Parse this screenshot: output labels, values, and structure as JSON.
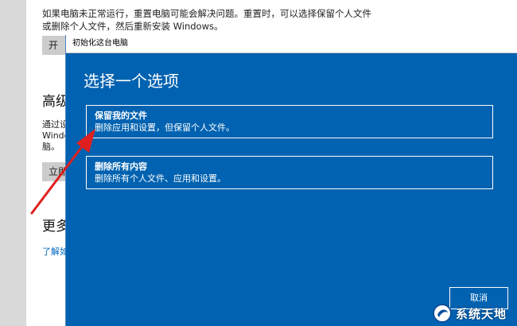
{
  "background": {
    "description": "如果电脑未正常运行，重置电脑可能会解决问题。重置时，可以选择保留个人文件或删除个人文件，然后重新安装 Windows。",
    "start_button_label": "开",
    "advanced_heading": "高级",
    "advanced_text_1": "通过设",
    "advanced_text_2": "Windo",
    "advanced_text_3": "脑。",
    "restart_button_label": "立即",
    "more_heading": "更多",
    "learn_link": "了解如"
  },
  "dialog": {
    "title": "初始化这台电脑",
    "heading": "选择一个选项",
    "options": [
      {
        "title": "保留我的文件",
        "description": "删除应用和设置，但保留个人文件。"
      },
      {
        "title": "删除所有内容",
        "description": "删除所有个人文件、应用和设置。"
      }
    ],
    "cancel_label": "取消"
  },
  "colors": {
    "dialog_bg": "#0062b0",
    "arrow": "#e02020",
    "link": "#0067c0"
  },
  "watermark": {
    "text": "系统天地"
  }
}
